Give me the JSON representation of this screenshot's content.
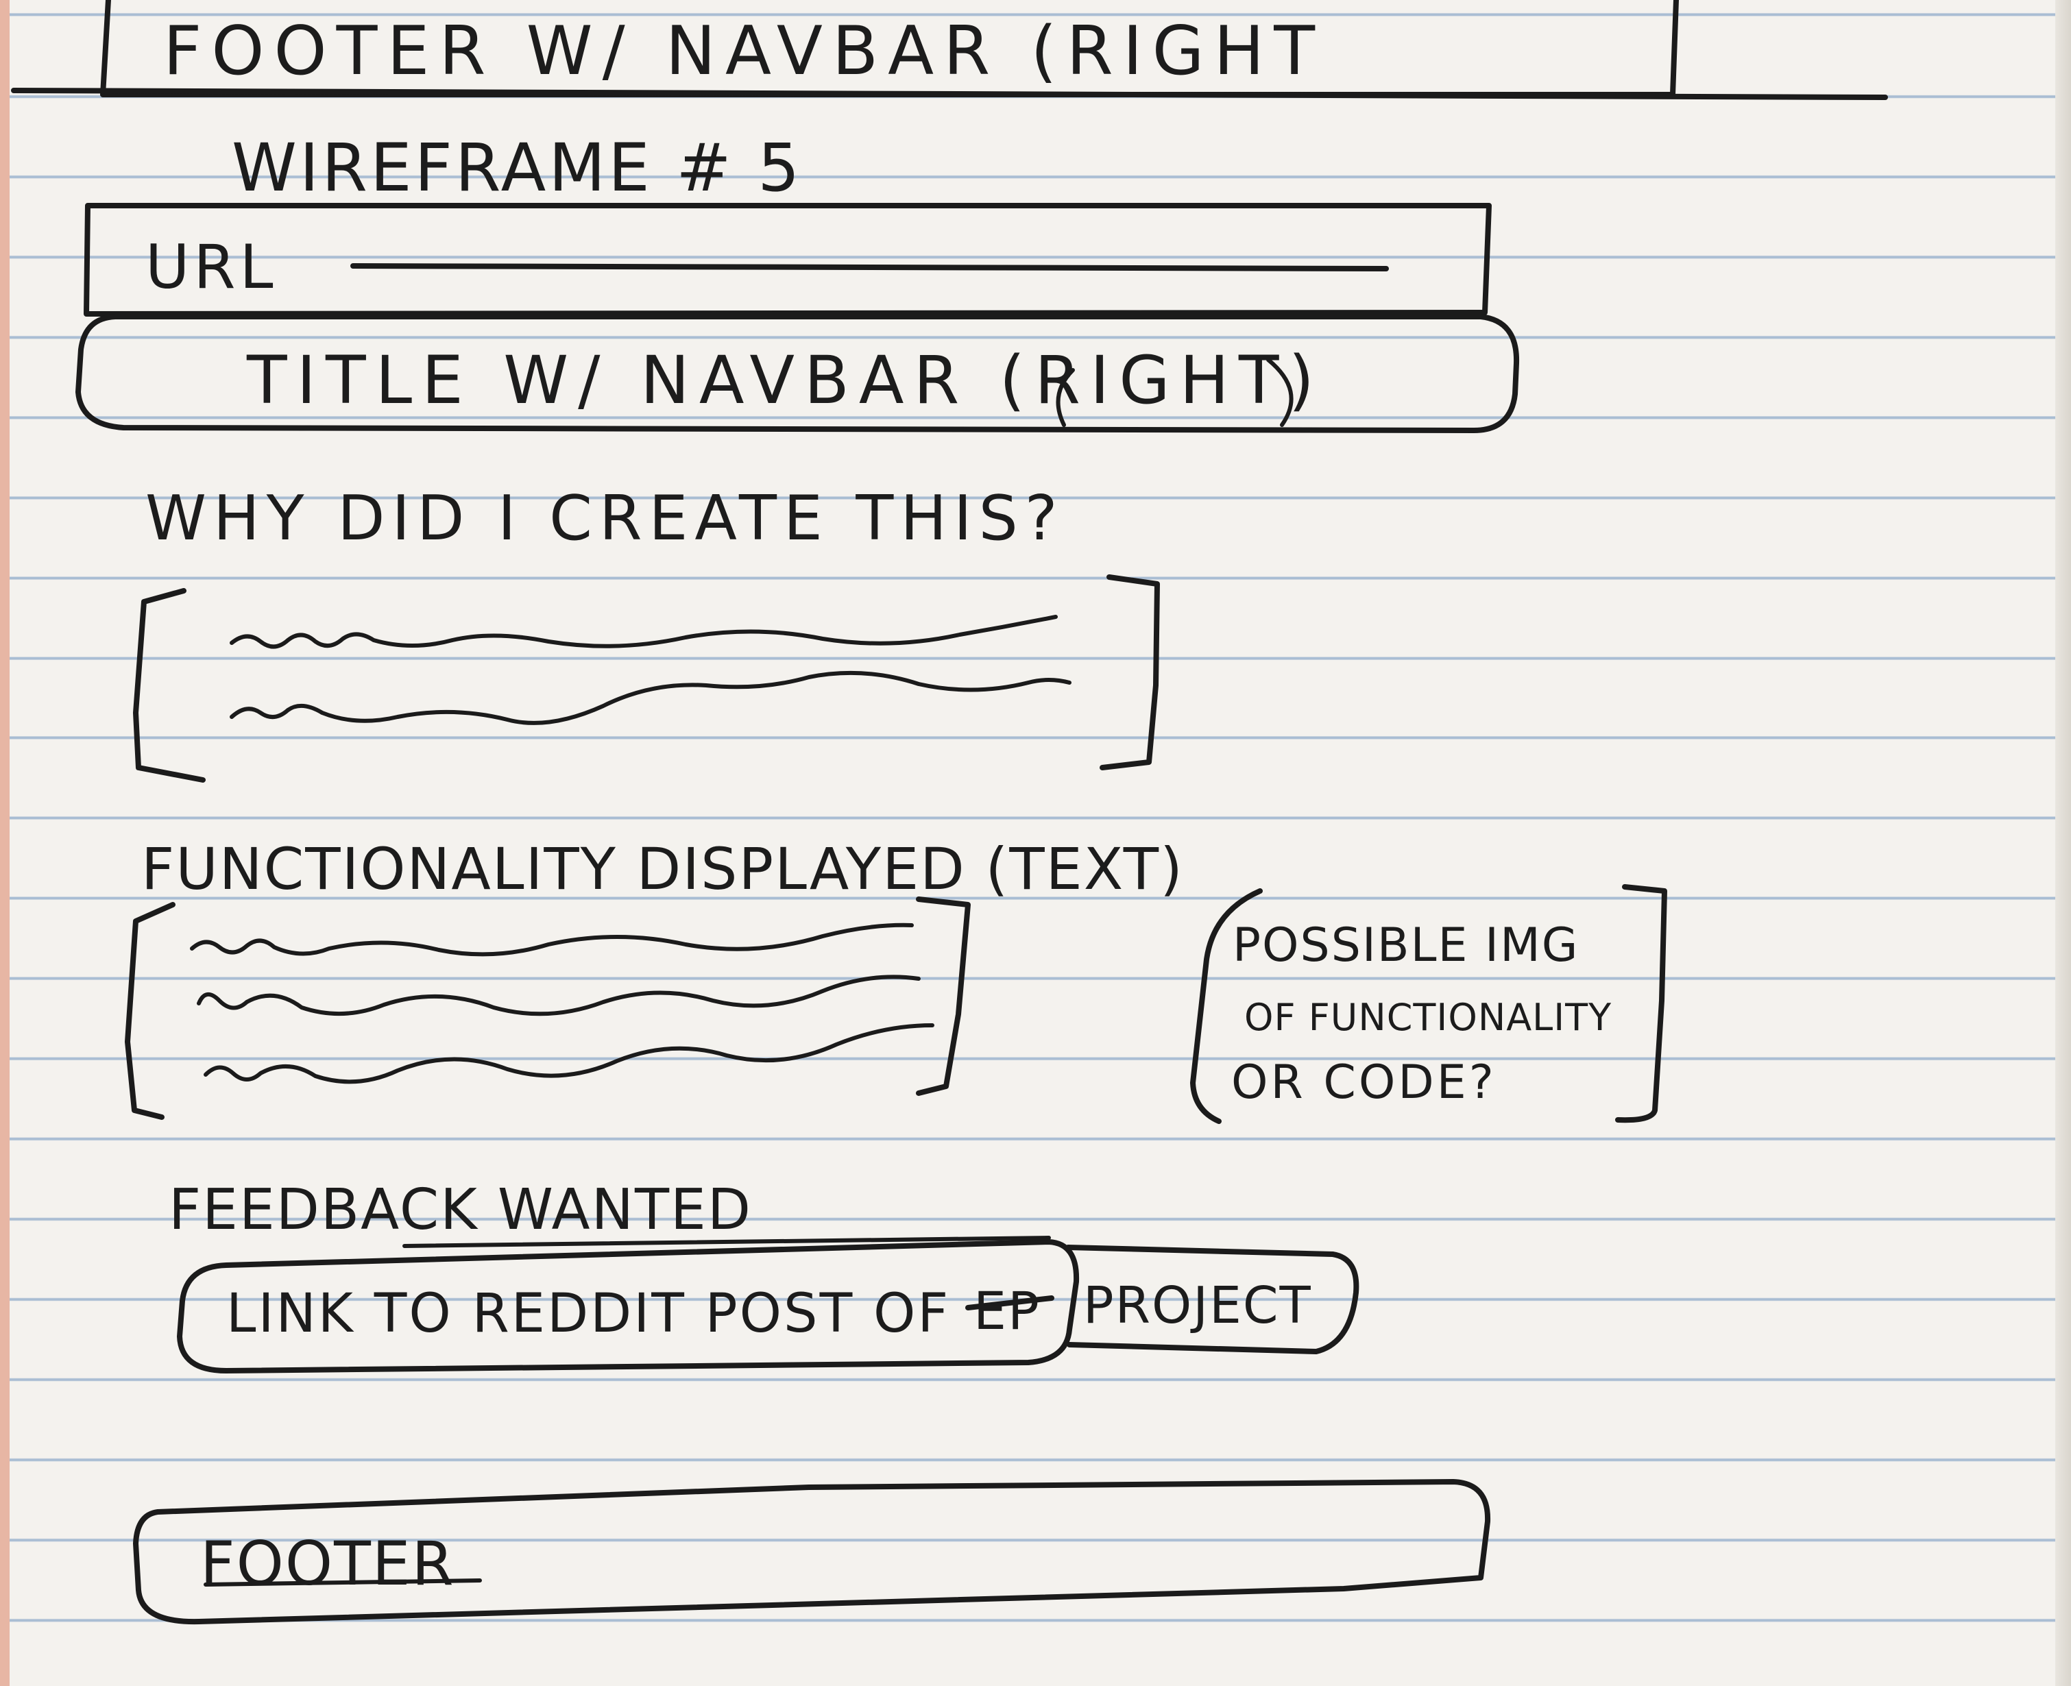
{
  "wireframe": {
    "top_footer_label": "FOOTER W/ NAVBAR (RIGHT",
    "title": "WIREFRAME # 5",
    "url_label": "URL",
    "header_label": "TITLE W/ NAVBAR (RIGHT)",
    "why_heading": "WHY DID I CREATE THIS?",
    "functionality_heading": "FUNCTIONALITY DISPLAYED (TEXT)",
    "image_box_label_line1": "POSSIBLE IMG",
    "image_box_label_line2": "OF FUNCTIONALITY",
    "image_box_label_line3": "OR CODE?",
    "feedback_heading": "FEEDBACK WANTED",
    "link_button_label": "LINK TO REDDIT POST OF",
    "link_button_struck": "EP",
    "link_button_tail": "PROJECT",
    "footer_label": "FOOTER"
  }
}
